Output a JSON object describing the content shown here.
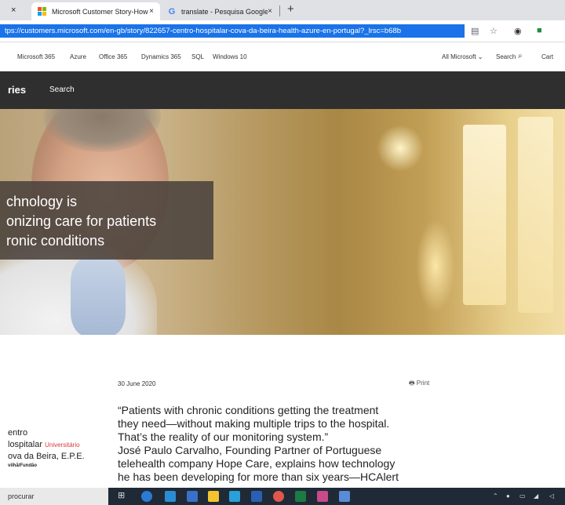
{
  "browser": {
    "first_tab_close": "×",
    "tabs": [
      {
        "title": "Microsoft Customer Story-How i",
        "close": "×"
      },
      {
        "title": "translate - Pesquisa Google",
        "close": "×"
      }
    ],
    "new_tab": "+",
    "url": "tps://customers.microsoft.com/en-gb/story/822657-centro-hospitalar-cova-da-beira-health-azure-en-portugal?_lrsc=b68b",
    "icons": [
      "reader-icon",
      "star-icon",
      "extension-icon",
      "profile-icon"
    ]
  },
  "ms_nav": {
    "links": [
      "Microsoft 365",
      "Azure",
      "Office 365",
      "Dynamics 365",
      "SQL",
      "Windows 10"
    ],
    "all_microsoft": "All Microsoft ⌄",
    "search": "Search",
    "cart": "Cart"
  },
  "stories_bar": {
    "title": "ries",
    "search": "Search"
  },
  "hero": {
    "headline": "chnology is\nonizing care for patients\nronic conditions"
  },
  "article": {
    "date": "30 June 2020",
    "print": "Print",
    "quote_lines": [
      "“Patients with chronic conditions getting the treatment",
      "they need—without making multiple trips to the hospital.",
      "That’s the reality of our monitoring system.”",
      "José Paulo Carvalho, Founding Partner of Portuguese",
      "telehealth company Hope Care, explains how technology",
      "he has been developing for more than six years—HCAlert"
    ]
  },
  "customer_logo": {
    "line1": "entro",
    "line2": "lospitalar",
    "line2_accent": "Universitário",
    "line3": "ova da Beira, E.P.E.",
    "line4": "vilhã/Fundão"
  },
  "taskbar": {
    "search_placeholder": "procurar"
  },
  "colors": {
    "url_highlight": "#1a73e8",
    "dark_bar": "#2f2f2f",
    "taskbar": "#1f2a36"
  }
}
